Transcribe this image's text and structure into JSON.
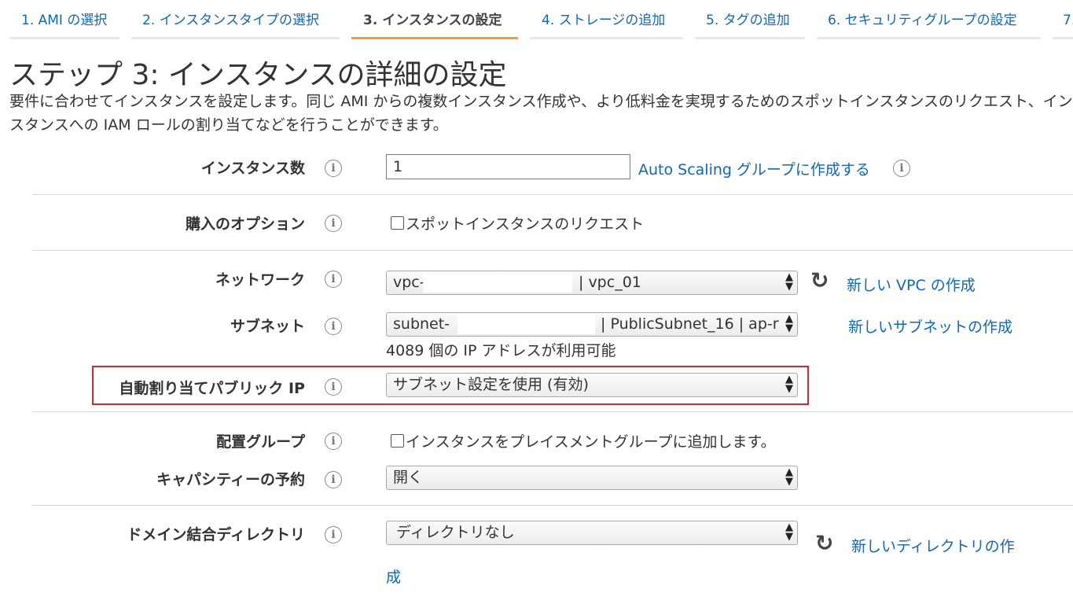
{
  "tabs": [
    {
      "label": "1. AMI の選択",
      "active": false
    },
    {
      "label": "2. インスタンスタイプの選択",
      "active": false
    },
    {
      "label": "3. インスタンスの設定",
      "active": true
    },
    {
      "label": "4. ストレージの追加",
      "active": false
    },
    {
      "label": "5. タグの追加",
      "active": false
    },
    {
      "label": "6. セキュリティグループの設定",
      "active": false
    },
    {
      "label": "7.",
      "active": false
    }
  ],
  "header": {
    "title": "ステップ 3: インスタンスの詳細の設定",
    "description": "要件に合わせてインスタンスを設定します。同じ AMI からの複数インスタンス作成や、より低料金を実現するためのスポットインスタンスのリクエスト、インスタンスへの IAM ロールの割り当てなどを行うことができます。"
  },
  "form": {
    "instance_count": {
      "label": "インスタンス数",
      "value": "1",
      "link": "Auto Scaling グループに作成する"
    },
    "purchase_option": {
      "label": "購入のオプション",
      "checkbox_label": "スポットインスタンスのリクエスト",
      "checked": false
    },
    "network": {
      "label": "ネットワーク",
      "value_prefix": "vpc-",
      "value_suffix": "| vpc_01",
      "link": "新しい VPC の作成"
    },
    "subnet": {
      "label": "サブネット",
      "value_prefix": "subnet-",
      "value_suffix": "| PublicSubnet_16 | ap-r",
      "link": "新しいサブネットの作成",
      "note": "4089 個の IP アドレスが利用可能"
    },
    "public_ip": {
      "label": "自動割り当てパブリック IP",
      "value": "サブネット設定を使用 (有効)"
    },
    "placement_group": {
      "label": "配置グループ",
      "checkbox_label": "インスタンスをプレイスメントグループに追加します。",
      "checked": false
    },
    "capacity_reservation": {
      "label": "キャパシティーの予約",
      "value": "開く"
    },
    "domain_directory": {
      "label": "ドメイン結合ディレクトリ",
      "value": "ディレクトリなし",
      "link_line1": "新しいディレクトリの作",
      "link_line2": "成"
    }
  },
  "icons": {
    "info": "i",
    "refresh": "↻",
    "select_arrow": "⬍"
  },
  "colors": {
    "link": "#1166bb",
    "active_tab_underline": "#f0a030",
    "highlight": "#d9232e"
  }
}
